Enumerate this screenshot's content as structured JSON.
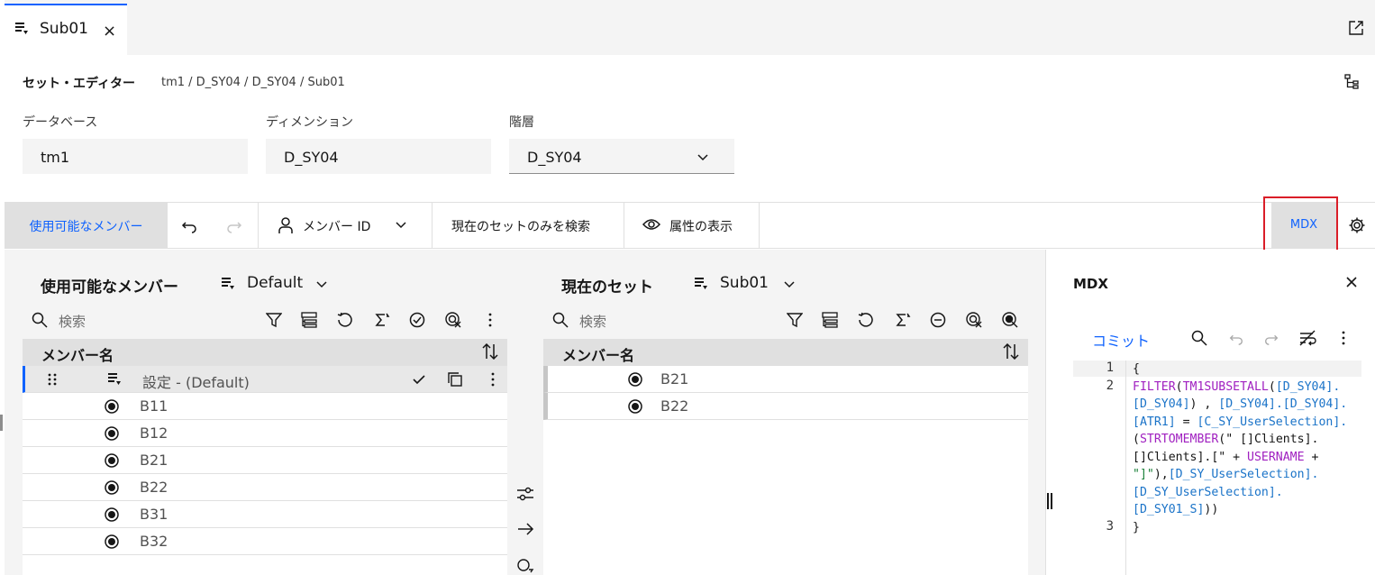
{
  "tab": {
    "label": "Sub01",
    "close": "×"
  },
  "editor": {
    "title": "セット・エディター",
    "breadcrumb": "tm1 / D_SY04 / D_SY04 / Sub01"
  },
  "fields": {
    "database": {
      "label": "データベース",
      "value": "tm1"
    },
    "dimension": {
      "label": "ディメンション",
      "value": "D_SY04"
    },
    "hierarchy": {
      "label": "階層",
      "value": "D_SY04"
    }
  },
  "toolbar": {
    "available_members": "使用可能なメンバー",
    "member_id": "メンバー ID",
    "search_current_set": "現在のセットのみを検索",
    "show_attributes": "属性の表示",
    "mdx": "MDX"
  },
  "left_panel": {
    "title": "使用可能なメンバー",
    "dropdown": "Default",
    "search_placeholder": "検索",
    "column_header": "メンバー名",
    "rows": [
      {
        "label": "設定 - (Default)",
        "icon": "subset-icon"
      },
      {
        "label": "B11",
        "icon": "member-icon"
      },
      {
        "label": "B12",
        "icon": "member-icon"
      },
      {
        "label": "B21",
        "icon": "member-icon"
      },
      {
        "label": "B22",
        "icon": "member-icon"
      },
      {
        "label": "B31",
        "icon": "member-icon"
      },
      {
        "label": "B32",
        "icon": "member-icon"
      }
    ]
  },
  "right_panel": {
    "title": "現在のセット",
    "dropdown": "Sub01",
    "search_placeholder": "検索",
    "column_header": "メンバー名",
    "rows": [
      {
        "label": "B21",
        "icon": "member-icon"
      },
      {
        "label": "B22",
        "icon": "member-icon"
      }
    ]
  },
  "mdx_panel": {
    "title": "MDX",
    "commit": "コミット",
    "line_numbers": [
      "1",
      "2",
      "3"
    ],
    "code": "{\nFILTER(TM1SUBSETALL([D_SY04].\n[D_SY04]) , [D_SY04].[D_SY04].\n[ATR1] = [C_SY_UserSelection].\n(STRTOMEMBER(\" []Clients].\n[]Clients].[\" + USERNAME +\n\"]\"),[D_SY_UserSelection].\n[D_SY_UserSelection].\n[D_SY01_S]))\n}"
  },
  "colors": {
    "accent": "#0f62fe",
    "highlight_box": "#da1e28",
    "toolbar_active_bg": "#e0e0e0"
  }
}
